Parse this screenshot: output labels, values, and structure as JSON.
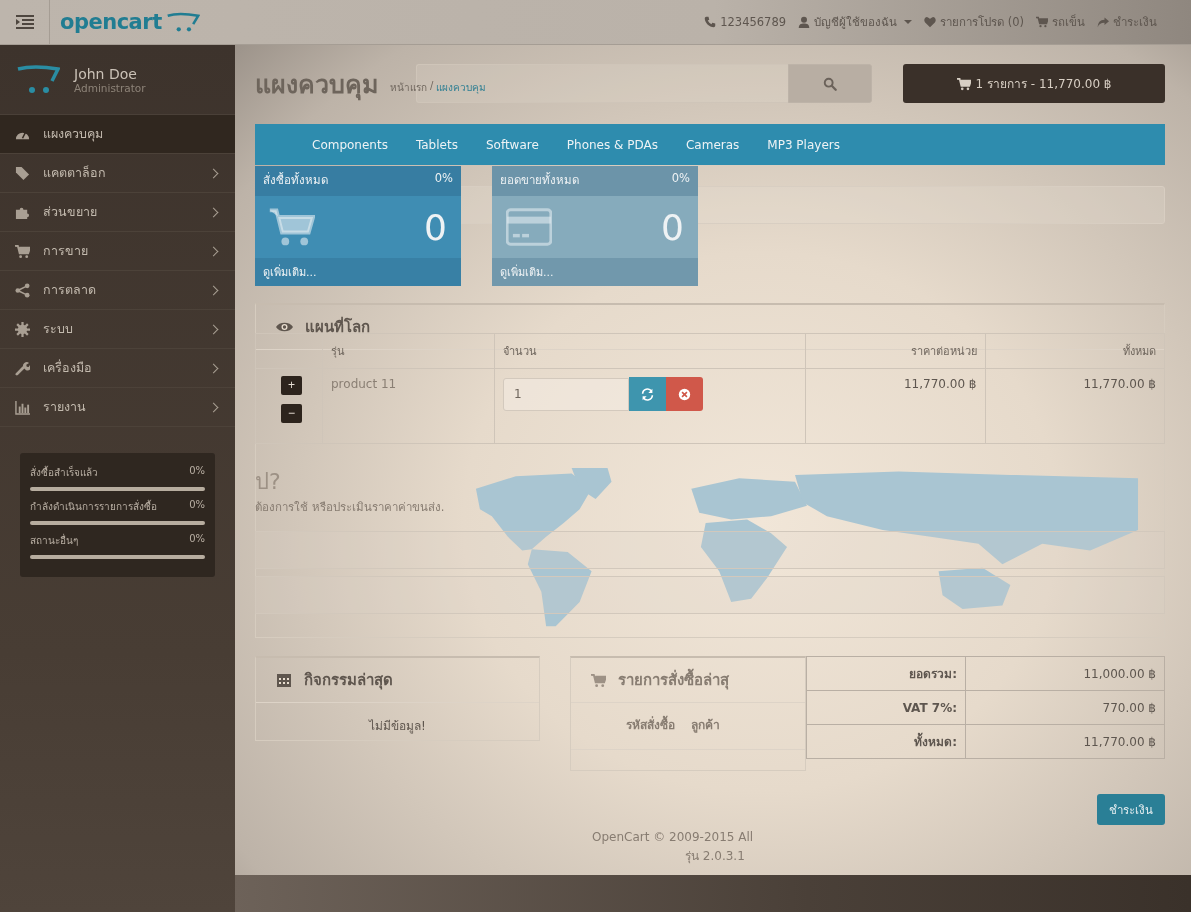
{
  "header": {
    "logo": "opencart",
    "links": [
      {
        "kind": "phone",
        "label": "123456789",
        "dropdown": false
      },
      {
        "kind": "account",
        "label": "บัญชีผู้ใช้ของฉัน",
        "dropdown": true
      },
      {
        "kind": "wishlist",
        "label": "รายการโปรด (0)",
        "dropdown": false
      },
      {
        "kind": "cart",
        "label": "รถเข็น",
        "dropdown": false
      },
      {
        "kind": "checkout",
        "label": "ชำระเงิน",
        "dropdown": false
      }
    ]
  },
  "user": {
    "name": "John Doe",
    "role": "Administrator"
  },
  "menu": [
    {
      "kind": "dashboard",
      "label": "แผงควบคุม",
      "selected": true,
      "has_children": false
    },
    {
      "kind": "tag",
      "label": "แคตตาล็อก",
      "selected": false,
      "has_children": true
    },
    {
      "kind": "puzzle",
      "label": "ส่วนขยาย",
      "selected": false,
      "has_children": true
    },
    {
      "kind": "cart",
      "label": "การขาย",
      "selected": false,
      "has_children": true
    },
    {
      "kind": "share",
      "label": "การตลาด",
      "selected": false,
      "has_children": true
    },
    {
      "kind": "gear",
      "label": "ระบบ",
      "selected": false,
      "has_children": true
    },
    {
      "kind": "wrench",
      "label": "เครื่องมือ",
      "selected": false,
      "has_children": true
    },
    {
      "kind": "chart",
      "label": "รายงาน",
      "selected": false,
      "has_children": true
    }
  ],
  "order_stats": [
    {
      "label": "สั่งซื้อสำเร็จแล้ว",
      "value": "0%",
      "level": 0
    },
    {
      "label": "กำลังดำเนินการรายการสั่งซื้อ",
      "value": "0%",
      "level": 0
    },
    {
      "label": "สถานะอื่นๆ",
      "value": "0%",
      "level": 0
    }
  ],
  "dashboard": {
    "title": "แผงควบคุม",
    "breadcrumb": [
      "หน้าแรก",
      "แผงควบคุม"
    ],
    "breadcrumb_separator": "/",
    "tiles": [
      {
        "kind": "cart",
        "title": "สั่งซื้อทั้งหมด",
        "percent": "0%",
        "value": "0",
        "more": "ดูเพิ่มเติม..."
      },
      {
        "kind": "card",
        "title": "ยอดขายทั้งหมด",
        "percent": "0%",
        "value": "0",
        "more": "ดูเพิ่มเติม..."
      }
    ],
    "map": {
      "title": "แผนที่โลก",
      "zoom_in": "+",
      "zoom_out": "−"
    },
    "activity": {
      "title": "กิจกรรมล่าสุด",
      "empty": "ไม่มีข้อมูล!"
    },
    "latest_orders": {
      "title": "รายการสั่งซื้อล่าสุ",
      "columns": [
        "รหัสสั่งซื้อ",
        "ลูกค้า"
      ]
    },
    "footer": [
      "OpenCart © 2009-2015 All",
      "รุ่น 2.0.3.1"
    ]
  },
  "store": {
    "cart_button": "1 รายการ - 11,770.00 ฿",
    "categories": [
      "Components",
      "Tablets",
      "Software",
      "Phones & PDAs",
      "Cameras",
      "MP3 Players"
    ],
    "cart_table": {
      "columns": [
        "รุ่น",
        "จำนวน",
        "ราคาต่อหน่วย",
        "ทั้งหมด"
      ],
      "rows": [
        {
          "model": "product 11",
          "quantity": "1",
          "unit_price": "11,770.00 ฿",
          "total": "11,770.00 ฿"
        }
      ]
    },
    "shipping_heading": "ป?",
    "shipping_text": "ต้องการใช้ หรือประเมินราคาค่าขนส่ง.",
    "totals": [
      {
        "label": "ยอดรวม:",
        "value": "11,000.00 ฿"
      },
      {
        "label": "VAT 7%:",
        "value": "770.00 ฿"
      },
      {
        "label": "ทั้งหมด:",
        "value": "11,770.00 ฿"
      }
    ],
    "checkout_button": "ชำระเงิน"
  }
}
